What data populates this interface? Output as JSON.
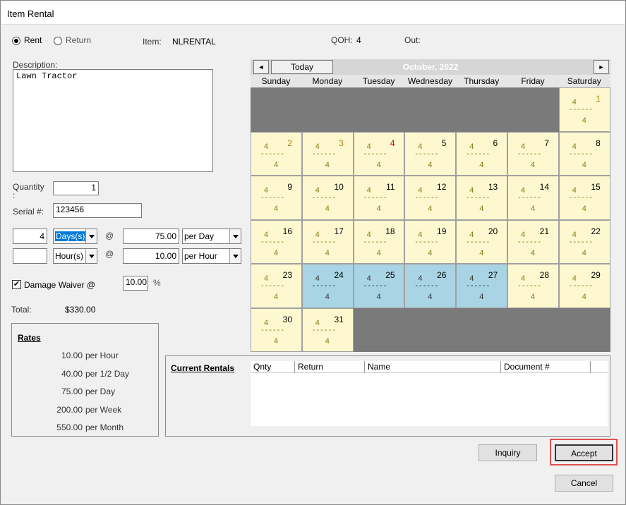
{
  "window": {
    "title": "Item Rental"
  },
  "mode": {
    "rent_label": "Rent",
    "return_label": "Return",
    "selected": "Rent"
  },
  "item": {
    "label": "Item:",
    "value": "NLRENTAL",
    "qoh_label": "QOH:",
    "qoh_value": "4",
    "out_label": "Out:"
  },
  "description": {
    "label": "Description:",
    "value": "Lawn Tractor"
  },
  "quantity": {
    "label": "Quantity :",
    "value": "1"
  },
  "serial": {
    "label": "Serial #:",
    "value": "123456"
  },
  "period1": {
    "count": "4",
    "unit": "Days(s)",
    "at": "@",
    "rate": "75.00",
    "per": "per Day"
  },
  "period2": {
    "count": "",
    "unit": "Hour(s)",
    "at": "@",
    "rate": "10.00",
    "per": "per Hour"
  },
  "waiver": {
    "label": "Damage Waiver @",
    "value": "10.00",
    "pct": "%",
    "checked": true
  },
  "total": {
    "label": "Total:",
    "value": "$330.00"
  },
  "rates": {
    "title": "Rates",
    "rows": [
      {
        "amount": "10.00",
        "unit": "per Hour"
      },
      {
        "amount": "40.00",
        "unit": "per 1/2 Day"
      },
      {
        "amount": "75.00",
        "unit": "per Day"
      },
      {
        "amount": "200.00",
        "unit": "per Week"
      },
      {
        "amount": "550.00",
        "unit": "per Month"
      }
    ]
  },
  "calendar": {
    "month": "October, 2022",
    "today_label": "Today",
    "prev": "◄",
    "next": "►",
    "days": [
      "Sunday",
      "Monday",
      "Tuesday",
      "Wednesday",
      "Thursday",
      "Friday",
      "Saturday"
    ],
    "avail": "4",
    "dash": "------",
    "first_weekday": 6,
    "num_days": 31,
    "highlighted": [
      24,
      25,
      26,
      27
    ]
  },
  "current_rentals": {
    "title": "Current Rentals",
    "columns": [
      "Qnty",
      "Return",
      "Name",
      "Document #"
    ]
  },
  "buttons": {
    "inquiry": "Inquiry",
    "accept": "Accept",
    "cancel": "Cancel"
  },
  "colors": {
    "cell": "#fdf8cf",
    "highlight": "#a9d4e4",
    "accept_outline": "#e05050",
    "blank": "#7a7a7a"
  }
}
